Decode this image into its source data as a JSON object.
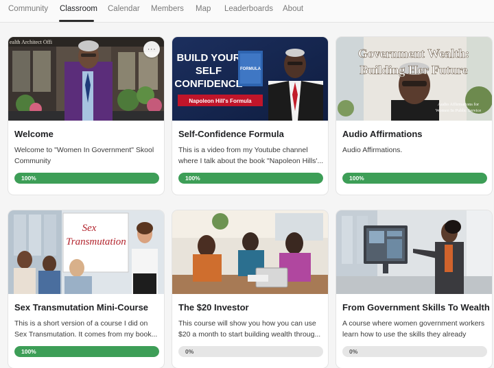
{
  "nav": {
    "tabs": [
      {
        "label": "Community",
        "active": false
      },
      {
        "label": "Classroom",
        "active": true
      },
      {
        "label": "Calendar",
        "active": false
      },
      {
        "label": "Members",
        "active": false
      },
      {
        "label": "Map",
        "active": false
      },
      {
        "label": "Leaderboards",
        "active": false
      },
      {
        "label": "About",
        "active": false
      }
    ]
  },
  "colors": {
    "accent_progress": "#3d9e57",
    "progress_track": "#e6e6e6",
    "active_tab_underline": "#2c2c2c"
  },
  "courses": [
    {
      "title": "Welcome",
      "description": "Welcome to \"Women In Government\" Skool Community",
      "progress_label": "100%",
      "progress": 1.0,
      "thumbnail": {
        "sign_text": "ealth Architect Offi"
      },
      "more_icon": "ellipsis-icon",
      "more_label": "···"
    },
    {
      "title": "Self-Confidence Formula",
      "description": "This is a video from my Youtube channel where I talk about the book \"Napoleon Hills'...",
      "progress_label": "100%",
      "progress": 1.0,
      "thumbnail": {
        "headline": [
          "BUILD YOUR",
          "SELF",
          "CONFIDENCE"
        ],
        "banner": "Napoleon Hill's Formula",
        "book_title": "FORMULA"
      }
    },
    {
      "title": "Audio Affirmations",
      "description": "Audio Affirmations.",
      "progress_label": "100%",
      "progress": 1.0,
      "thumbnail": {
        "headline": [
          "Government Wealth:",
          "Building Her Future"
        ],
        "caption": [
          "Audio Affirmations for",
          "Women In Public Service"
        ]
      }
    },
    {
      "title": "Sex Transmutation Mini-Course",
      "description": "This is a short version of a course I did on Sex Transmutation. It comes from my book...",
      "progress_label": "100%",
      "progress": 1.0,
      "thumbnail": {
        "board_text": [
          "Sex",
          "Transmutation"
        ]
      }
    },
    {
      "title": "The $20 Investor",
      "description": "This course will show you how you can use $20 a month to start building wealth throug...",
      "progress_label": "0%",
      "progress": 0.0,
      "thumbnail": {}
    },
    {
      "title": "From Government Skills To Wealth",
      "description": "A course where women government workers learn how to use the skills they already have...",
      "progress_label": "0%",
      "progress": 0.0,
      "thumbnail": {}
    }
  ]
}
